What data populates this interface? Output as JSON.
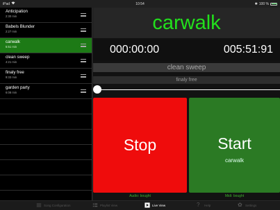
{
  "status_bar": {
    "device": "iPad",
    "time": "10:54",
    "battery": "100 %",
    "battery_level": 1.0
  },
  "sidebar": {
    "songs": [
      {
        "title": "Anticipation",
        "duration": "2:30 min",
        "selected": false
      },
      {
        "title": "Babels Blunder",
        "duration": "2:27 min",
        "selected": false
      },
      {
        "title": "carwalk",
        "duration": "5:51 min",
        "selected": true
      },
      {
        "title": "clean sweep",
        "duration": "4:21 min",
        "selected": false
      },
      {
        "title": "finaly free",
        "duration": "9:33 min",
        "selected": false
      },
      {
        "title": "garden party",
        "duration": "6:08 min",
        "selected": false
      }
    ]
  },
  "main": {
    "current_song": "carwalk",
    "elapsed": "000:00:00",
    "remaining": "005:51:91",
    "next_song": "clean sweep",
    "after_next_song": "finaly free",
    "progress": 0.0,
    "stop_label": "Stop",
    "start_label": "Start",
    "start_sub": "carwalk",
    "audio_status": "Audio: bought",
    "midi_status": "Midi: bought"
  },
  "tabbar": {
    "tabs": [
      {
        "label": "Song Configuration",
        "icon": "list-settings-icon",
        "active": false
      },
      {
        "label": "Playlist View",
        "icon": "playlist-icon",
        "active": false
      },
      {
        "label": "Live View",
        "icon": "play-icon",
        "active": true
      },
      {
        "label": "Help",
        "icon": "help-icon",
        "active": false
      },
      {
        "label": "Settings",
        "icon": "gear-icon",
        "active": false
      }
    ]
  },
  "colors": {
    "accent_green": "#22e01c",
    "selected_row": "#1d7a16",
    "stop_red": "#ef0c0c",
    "start_green": "#2b7a24"
  }
}
